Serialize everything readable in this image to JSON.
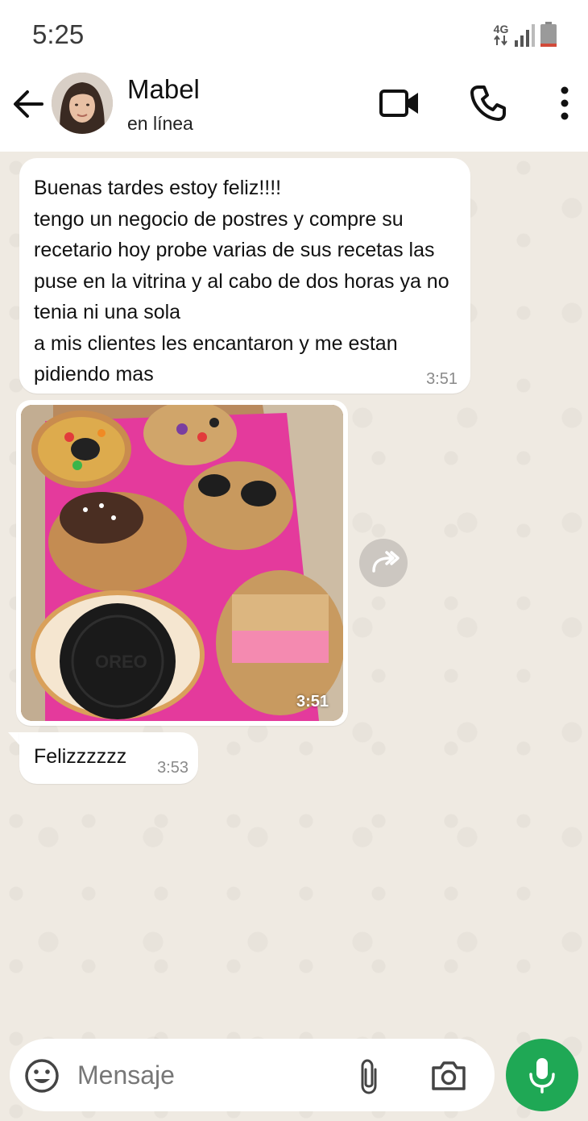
{
  "status_bar": {
    "time": "5:25",
    "network_label": "4G",
    "battery_color": "#d14a3a"
  },
  "header": {
    "contact_name": "Mabel",
    "contact_status": "en línea",
    "icons": [
      "back-arrow-icon",
      "video-call-icon",
      "phone-icon",
      "more-vertical-icon"
    ]
  },
  "messages": [
    {
      "type": "text",
      "text": "Buenas tardes estoy feliz!!!!\ntengo un negocio de postres y compre su recetario hoy probe varias de sus recetas las puse en la vitrina y al cabo de dos horas ya no tenia ni una sola\na mis clientes les encantaron y me estan pidiendo mas",
      "time": "3:51"
    },
    {
      "type": "image",
      "time": "3:51",
      "forward_icon": "forward-icon"
    },
    {
      "type": "text",
      "text": "Felizzzzzz",
      "time": "3:53"
    }
  ],
  "composer": {
    "placeholder": "Mensaje",
    "icons": [
      "emoji-icon",
      "paperclip-icon",
      "camera-icon",
      "microphone-icon"
    ],
    "mic_color": "#1fa855"
  },
  "colors": {
    "chat_background": "#efeae2",
    "bubble": "#ffffff"
  }
}
